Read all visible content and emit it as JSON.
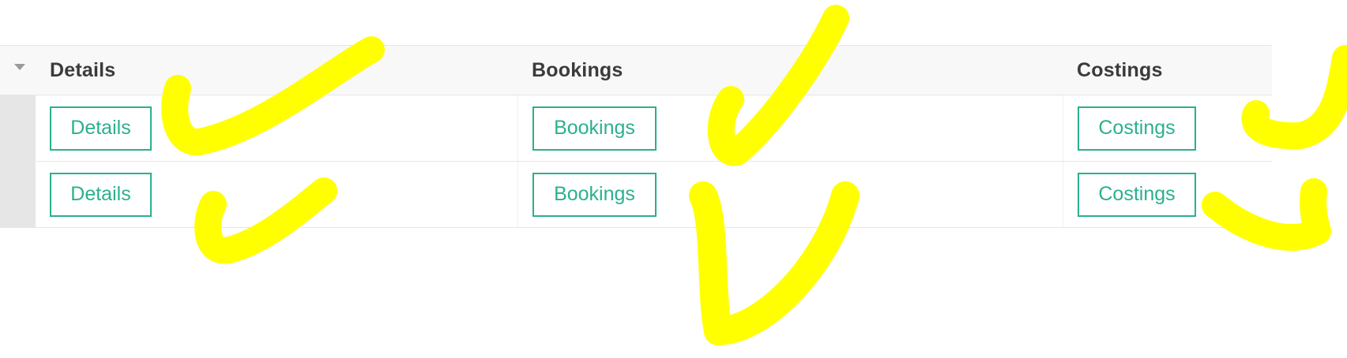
{
  "table": {
    "columns": [
      {
        "label": "Details"
      },
      {
        "label": "Bookings"
      },
      {
        "label": "Costings"
      }
    ],
    "rows": [
      {
        "details_button": "Details",
        "bookings_button": "Bookings",
        "costings_button": "Costings"
      },
      {
        "details_button": "Details",
        "bookings_button": "Bookings",
        "costings_button": "Costings"
      }
    ]
  },
  "colors": {
    "accent": "#2bb08f",
    "header_background": "#f8f8f8",
    "row_rail": "#e6e6e6",
    "annotation": "#ffff00"
  },
  "annotations": {
    "type": "checkmark",
    "count": 6
  }
}
